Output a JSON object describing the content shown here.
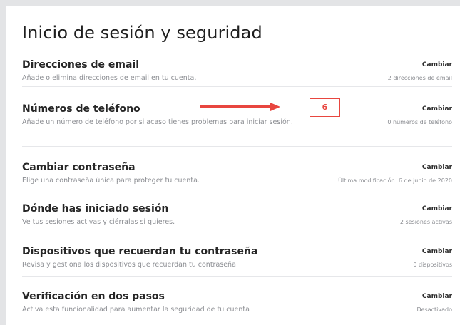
{
  "page": {
    "title": "Inicio de sesión y seguridad"
  },
  "rows": [
    {
      "title": "Direcciones de email",
      "description": "Añade o elimina direcciones de email en tu cuenta.",
      "action": "Cambiar",
      "status": "2 direcciones de email"
    },
    {
      "title": "Números de teléfono",
      "description": "Añade un número de teléfono por si acaso tienes problemas para iniciar sesión.",
      "action": "Cambiar",
      "status": "0 números de teléfono"
    },
    {
      "title": "Cambiar contraseña",
      "description": "Elige una contraseña única para proteger tu cuenta.",
      "action": "Cambiar",
      "status": "Última modificación: 6 de junio de 2020"
    },
    {
      "title": "Dónde has iniciado sesión",
      "description": "Ve tus sesiones activas y ciérralas si quieres.",
      "action": "Cambiar",
      "status": "2 sesiones activas"
    },
    {
      "title": "Dispositivos que recuerdan tu contraseña",
      "description": "Revisa y gestiona los dispositivos que recuerdan tu contraseña",
      "action": "Cambiar",
      "status": "0 dispositivos"
    },
    {
      "title": "Verificación en dos pasos",
      "description": "Activa esta funcionalidad para aumentar la seguridad de tu cuenta",
      "action": "Cambiar",
      "status": "Desactivado"
    }
  ],
  "annotation": {
    "label": "6",
    "color": "#e8463f",
    "icon": "arrow-right-icon"
  }
}
